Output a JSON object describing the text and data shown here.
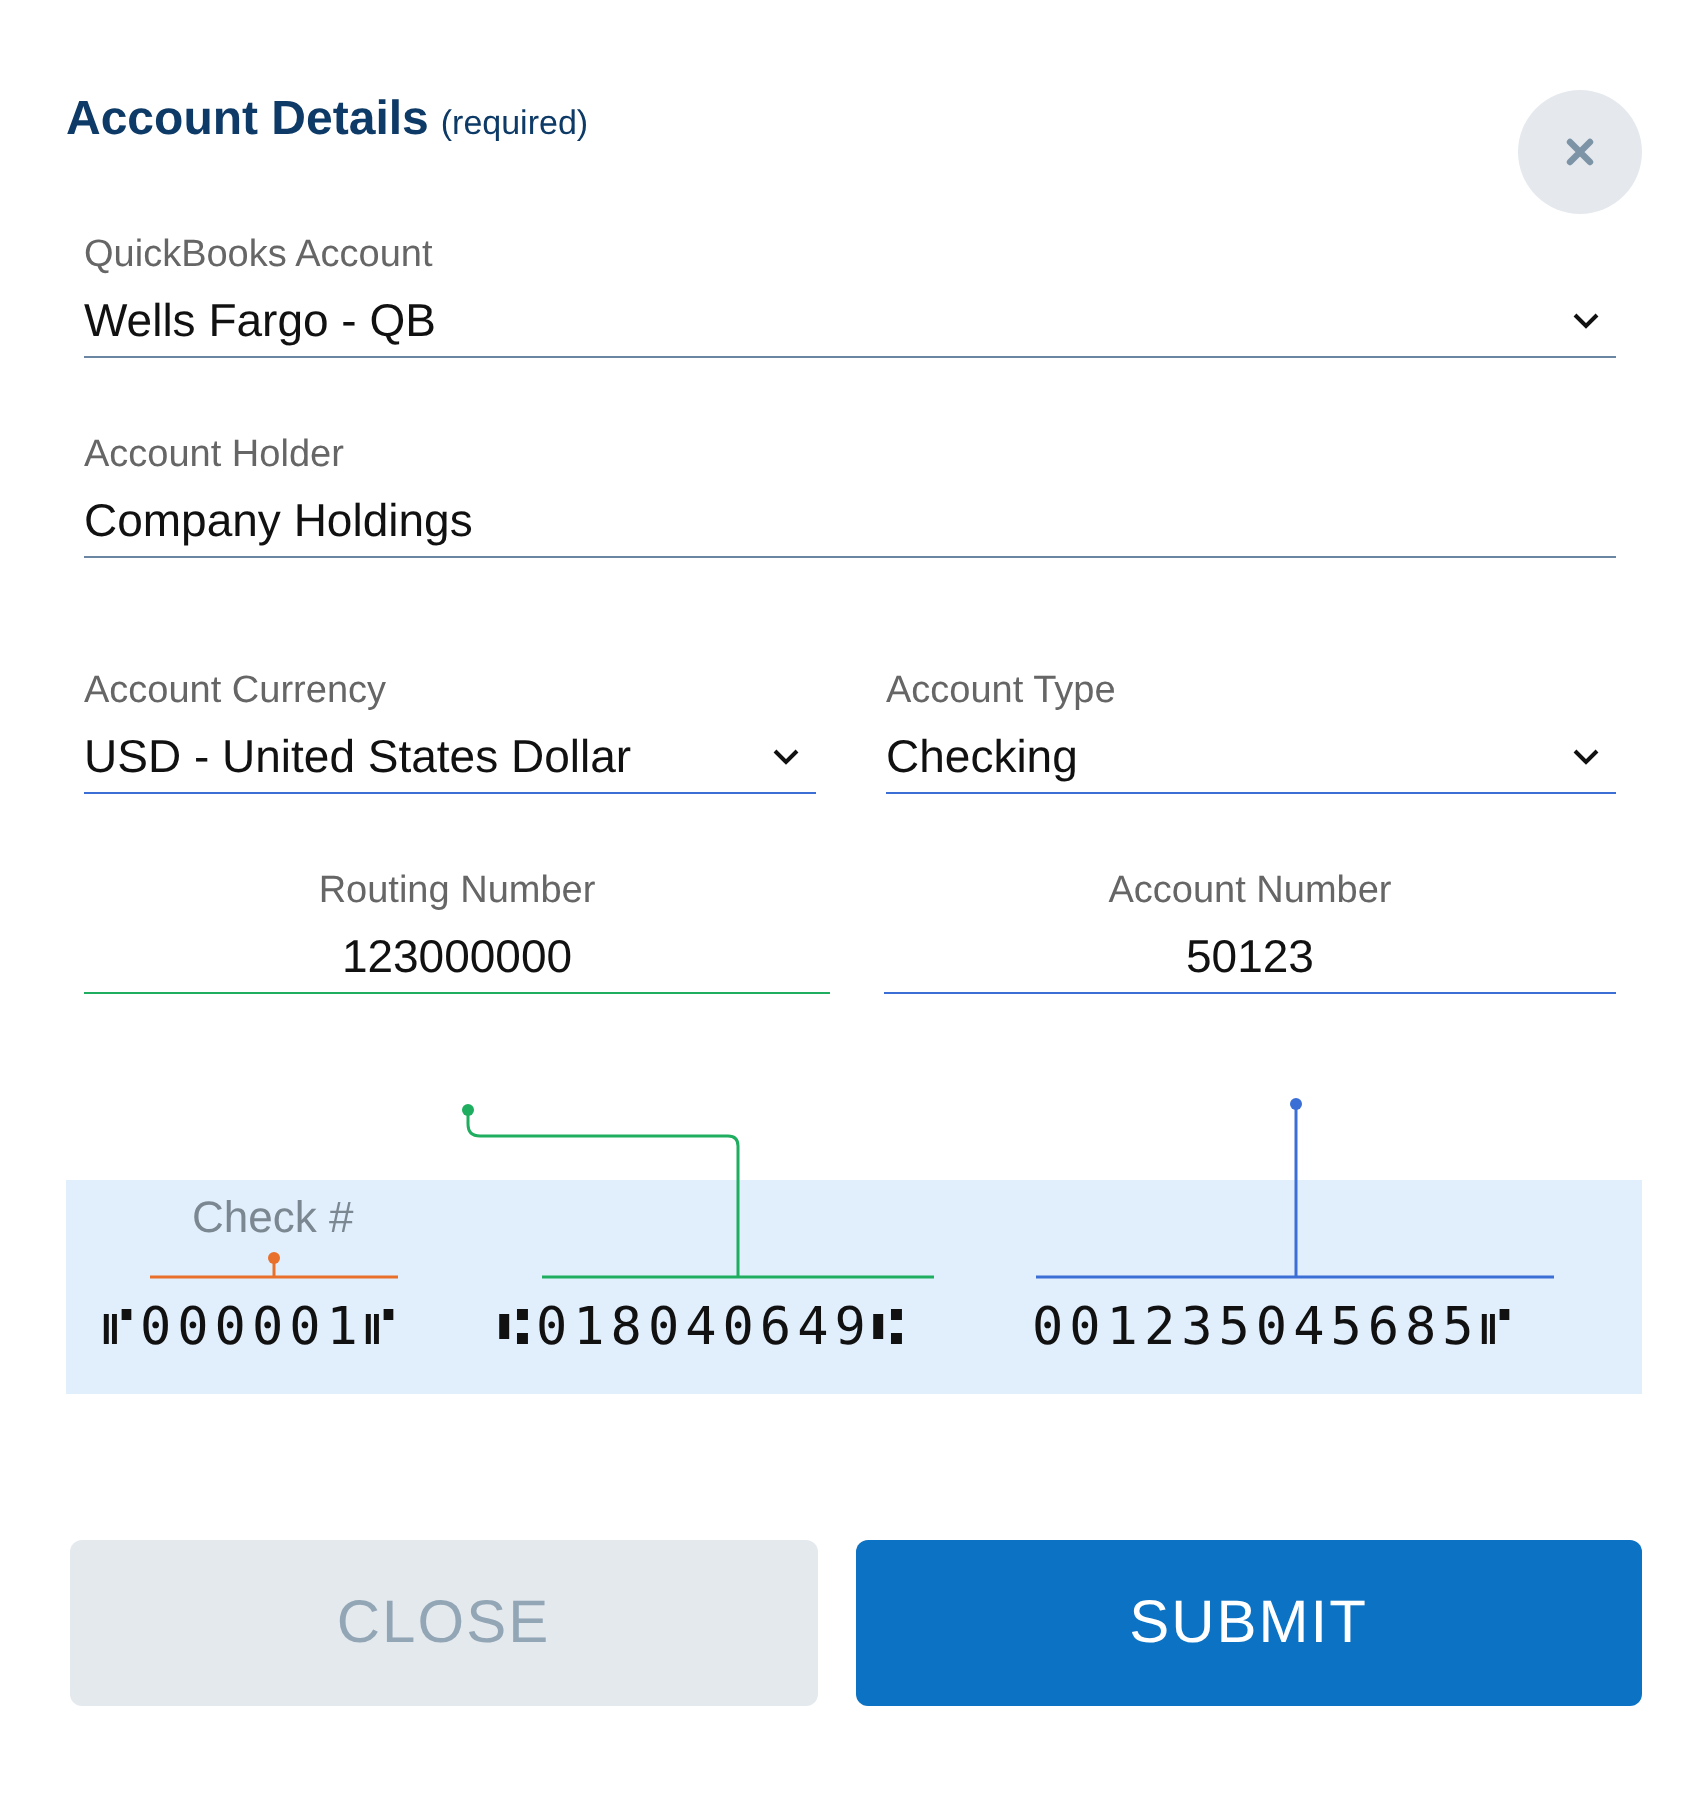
{
  "header": {
    "title": "Account Details",
    "note": "(required)"
  },
  "fields": [
    {
      "kind": "select",
      "label": "QuickBooks Account",
      "value": "Wells Fargo - QB"
    },
    {
      "kind": "text",
      "label": "Account Holder",
      "value": "Company Holdings"
    }
  ],
  "row_fields": [
    {
      "kind": "select",
      "label": "Account Currency",
      "value": "USD - United States Dollar"
    },
    {
      "kind": "select",
      "label": "Account Type",
      "value": "Checking"
    }
  ],
  "bank_fields": [
    {
      "label": "Routing Number",
      "value": "123000000"
    },
    {
      "label": "Account Number",
      "value": "50123"
    }
  ],
  "check": {
    "label": "Check #",
    "micr": [
      {
        "text": "⑈000001⑈",
        "color": "#e8702a"
      },
      {
        "text": "⑆018040649⑆",
        "color": "#1fad5f"
      },
      {
        "text": "001235045685⑈",
        "color": "#3b6fd6"
      }
    ]
  },
  "buttons": [
    {
      "kind": "secondary",
      "label": "CLOSE"
    },
    {
      "kind": "primary",
      "label": "SUBMIT"
    }
  ]
}
